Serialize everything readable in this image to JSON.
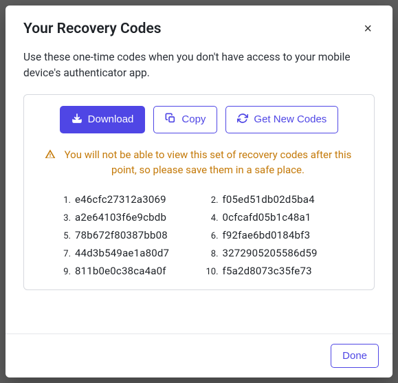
{
  "modal": {
    "title": "Your Recovery Codes",
    "close_label": "×",
    "instructions": "Use these one-time codes when you don't have access to your mobile device's authenticator app.",
    "buttons": {
      "download": "Download",
      "copy": "Copy",
      "get_new": "Get New Codes"
    },
    "warning": "You will not be able to view this set of recovery codes after this point, so please save them in a safe place.",
    "codes": [
      "e46cfc27312a3069",
      "f05ed51db02d5ba4",
      "a2e64103f6e9cbdb",
      "0cfcafd05b1c48a1",
      "78b672f80387bb08",
      "f92fae6bd0184bf3",
      "44d3b549ae1a80d7",
      "3272905205586d59",
      "811b0e0c38ca4a0f",
      "f5a2d8073c35fe73"
    ],
    "footer": {
      "done": "Done"
    }
  }
}
